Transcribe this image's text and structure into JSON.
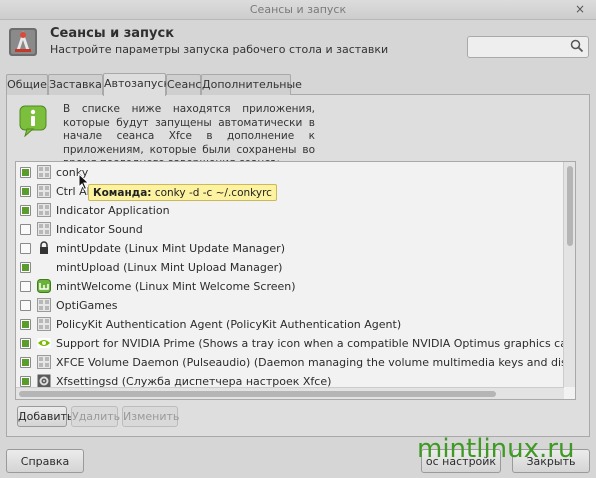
{
  "window": {
    "title": "Сеансы и запуск",
    "close_glyph": "×"
  },
  "header": {
    "title": "Сеансы и запуск",
    "subtitle": "Настройте параметры запуска рабочего стола и заставки"
  },
  "tabs": [
    {
      "label": "Общие"
    },
    {
      "label": "Заставка"
    },
    {
      "label": "Автозапуск"
    },
    {
      "label": "Сеанс"
    },
    {
      "label": "Дополнительные"
    }
  ],
  "info_text": "В списке ниже находятся приложения, которые будут запущены автоматически в начале сеанса Xfce в дополнение к приложениям, которые были сохранены во время последнего завершения сеанса:",
  "apps": [
    {
      "label": "conky",
      "checked": true,
      "icon": "generic-app-icon"
    },
    {
      "label": "Ctrl Alt Backspace to restart Xorg)",
      "checked": true,
      "icon": "generic-app-icon"
    },
    {
      "label": "Indicator Application",
      "checked": true,
      "icon": "generic-app-icon"
    },
    {
      "label": "Indicator Sound",
      "checked": false,
      "icon": "generic-app-icon"
    },
    {
      "label": "mintUpdate (Linux Mint Update Manager)",
      "checked": false,
      "icon": "lock-icon"
    },
    {
      "label": "mintUpload (Linux Mint Upload Manager)",
      "checked": true,
      "icon": "none"
    },
    {
      "label": "mintWelcome (Linux Mint Welcome Screen)",
      "checked": false,
      "icon": "mint-logo-icon"
    },
    {
      "label": "OptiGames",
      "checked": false,
      "icon": "generic-app-icon"
    },
    {
      "label": "PolicyKit Authentication Agent (PolicyKit Authentication Agent)",
      "checked": true,
      "icon": "generic-app-icon"
    },
    {
      "label": "Support for NVIDIA Prime (Shows a tray icon when a compatible NVIDIA Optimus graphics card is detected)",
      "checked": true,
      "icon": "nvidia-icon"
    },
    {
      "label": "XFCE Volume Daemon (Pulseaudio) (Daemon managing the volume multimedia keys and displaying volume notification",
      "checked": true,
      "icon": "generic-app-icon"
    },
    {
      "label": "Xfsettingsd (Служба диспетчера настроек Xfce)",
      "checked": true,
      "icon": "settings-icon"
    }
  ],
  "tooltip": {
    "label": "Команда:",
    "value": "conky -d -c ~/.conkyrc"
  },
  "buttons": {
    "add": "Добавить",
    "remove": "Удалить",
    "edit": "Изменить",
    "help": "Справка",
    "save_session": "ос настройк",
    "close": "Закрыть"
  },
  "watermark": "mintlinux.ru",
  "colors": {
    "check_green": "#5a9d2c",
    "watermark_green": "#3f9a23",
    "tooltip_bg": "#fdf2a0"
  }
}
